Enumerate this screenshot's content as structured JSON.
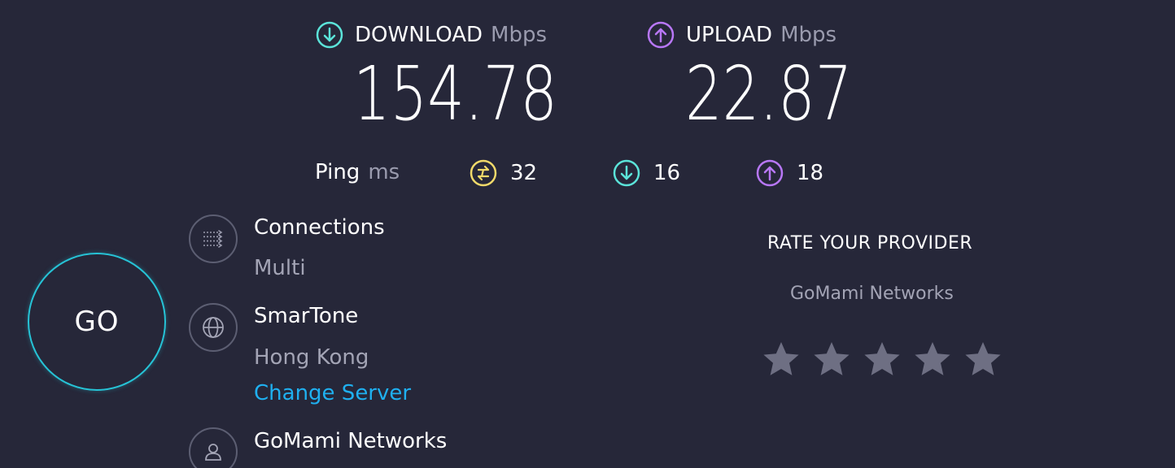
{
  "download": {
    "label": "DOWNLOAD",
    "unit": "Mbps",
    "value": "154.78",
    "icon": "arrow-down-circle-icon",
    "color": "#5be3d9"
  },
  "upload": {
    "label": "UPLOAD",
    "unit": "Mbps",
    "value": "22.87",
    "icon": "arrow-up-circle-icon",
    "color": "#b877f7"
  },
  "ping": {
    "label": "Ping",
    "unit": "ms",
    "idle": {
      "value": "32",
      "icon": "ping-idle-icon",
      "color": "#f0d96a"
    },
    "download": {
      "value": "16",
      "icon": "arrow-down-circle-icon",
      "color": "#5be3d9"
    },
    "upload": {
      "value": "18",
      "icon": "arrow-up-circle-icon",
      "color": "#b877f7"
    }
  },
  "go_button": {
    "label": "GO",
    "color": "#26c3d6"
  },
  "connections": {
    "title": "Connections",
    "value": "Multi",
    "icon": "connections-icon"
  },
  "server": {
    "title": "SmarTone",
    "location": "Hong Kong",
    "change_label": "Change Server",
    "icon": "globe-icon"
  },
  "provider": {
    "title": "GoMami Networks",
    "icon": "user-icon"
  },
  "rate": {
    "title": "RATE YOUR PROVIDER",
    "provider": "GoMami Networks",
    "stars": 5,
    "rating": 0
  },
  "colors": {
    "background": "#262739",
    "link": "#1fb0f0",
    "muted": "#a3a4b5",
    "star": "#6e6f83"
  }
}
